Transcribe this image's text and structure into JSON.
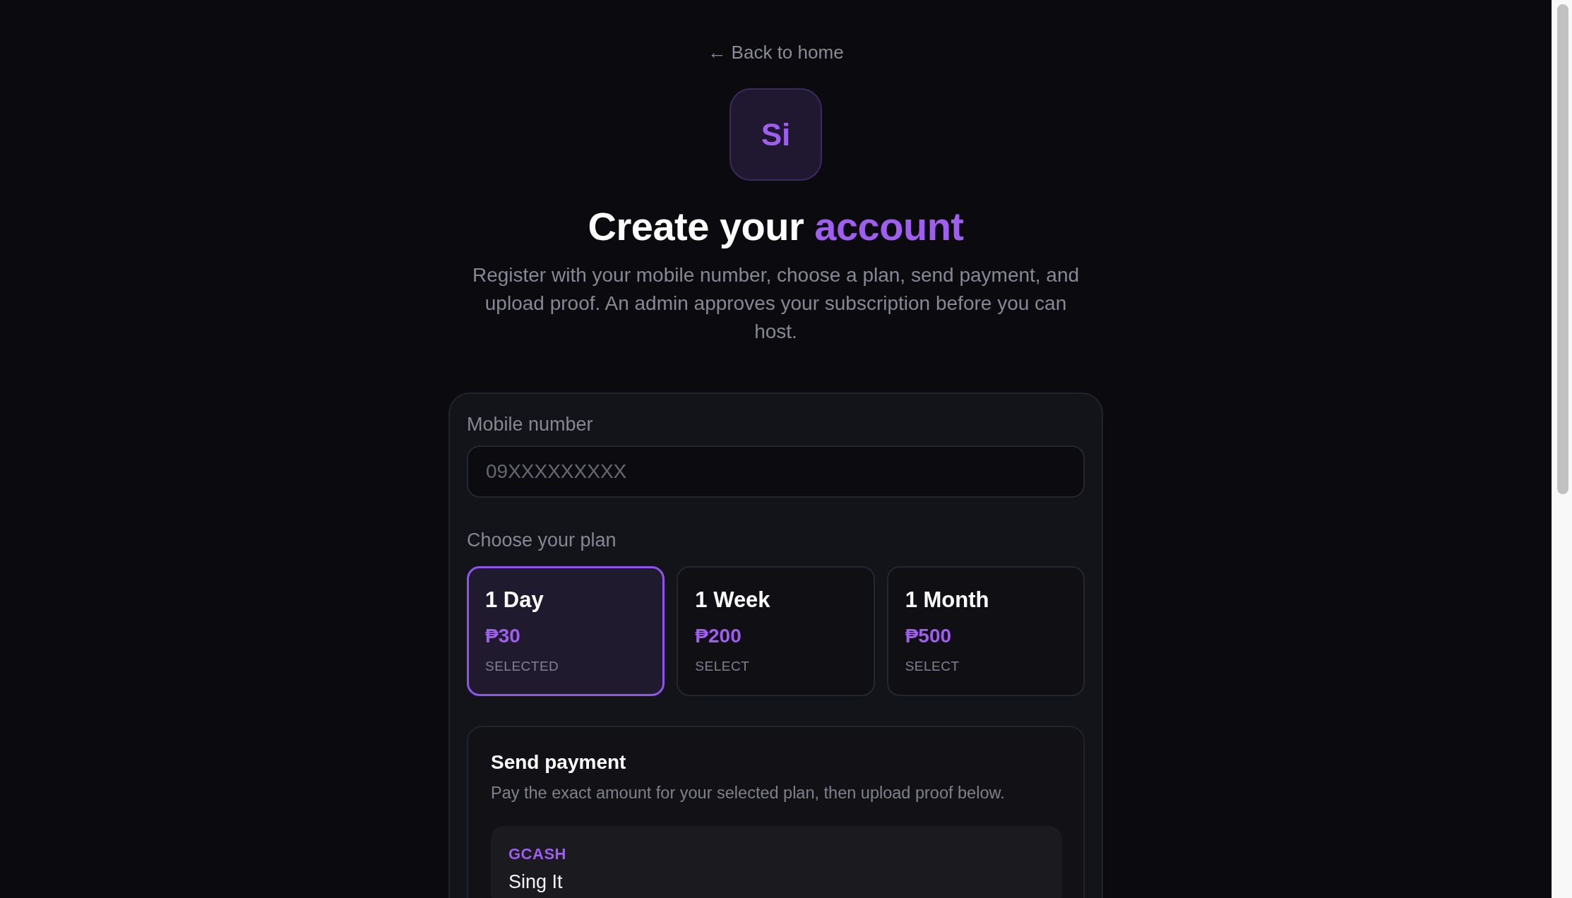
{
  "back_link": {
    "label": "← Back to home"
  },
  "logo": {
    "text": "Si"
  },
  "title": {
    "lead": "Create your",
    "accent": "account"
  },
  "subtitle": "Register with your mobile number, choose a plan, send payment, and upload proof. An admin approves your subscription before you can host.",
  "form": {
    "mobile": {
      "label": "Mobile number",
      "placeholder": "09XXXXXXXXX"
    },
    "plan_label": "Choose your plan",
    "plans": [
      {
        "name": "1 Day",
        "price": "₱30",
        "action": "SELECTED",
        "selected": true
      },
      {
        "name": "1 Week",
        "price": "₱200",
        "action": "SELECT",
        "selected": false
      },
      {
        "name": "1 Month",
        "price": "₱500",
        "action": "SELECT",
        "selected": false
      }
    ],
    "payment": {
      "title": "Send payment",
      "description": "Pay the exact amount for your selected plan, then upload proof below.",
      "methods": [
        {
          "provider": "GCASH",
          "account_name": "Sing It"
        }
      ]
    }
  }
}
